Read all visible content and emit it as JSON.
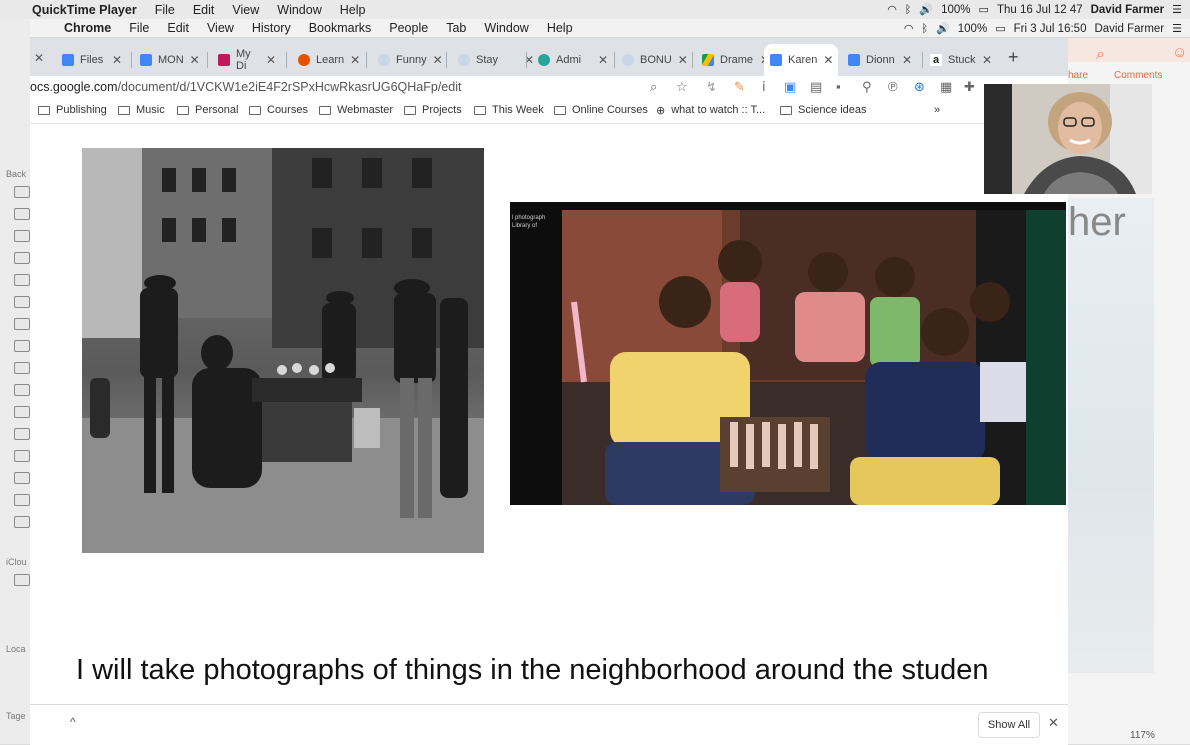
{
  "outer_menubar": {
    "app_name": "QuickTime Player",
    "items": [
      "File",
      "Edit",
      "View",
      "Window",
      "Help"
    ],
    "battery": "100%",
    "datetime": "Thu 16 Jul 12 47",
    "user": "David Farmer"
  },
  "inner_menubar": {
    "app_name": "Chrome",
    "items": [
      "File",
      "Edit",
      "View",
      "History",
      "Bookmarks",
      "People",
      "Tab",
      "Window",
      "Help"
    ],
    "battery": "100%",
    "datetime": "Fri 3 Jul 16:50",
    "user": "David Farmer"
  },
  "tabs": [
    {
      "label": "Files",
      "active": false,
      "color": "#4285f4"
    },
    {
      "label": "MON",
      "active": false,
      "color": "#4285f4"
    },
    {
      "label": "My Di",
      "active": false,
      "color": "#c2185b"
    },
    {
      "label": "Learn",
      "active": false,
      "color": "#e65100"
    },
    {
      "label": "Funny",
      "active": false,
      "color": "#bbbbbb"
    },
    {
      "label": "Stay",
      "active": false,
      "color": "#bbbbbb"
    },
    {
      "label": "Admi",
      "active": false,
      "color": "#26a69a"
    },
    {
      "label": "BONU",
      "active": false,
      "color": "#bbbbbb"
    },
    {
      "label": "Drame",
      "active": false,
      "color": "#fbbc04"
    },
    {
      "label": "Karen",
      "active": true,
      "color": "#4285f4"
    },
    {
      "label": "Dionn",
      "active": false,
      "color": "#4285f4"
    },
    {
      "label": "Stuck",
      "active": false,
      "color": "#222222"
    }
  ],
  "new_tab_symbol": "+",
  "url": {
    "host": "ocs.google.com",
    "path": "/document/d/1VCKW1e2iE4F2rSPxHcwRkasrUG6QHaFp/edit"
  },
  "bookmarks": [
    "Publishing",
    "Music",
    "Personal",
    "Courses",
    "Webmaster",
    "Projects",
    "This Week",
    "Online Courses",
    "what to watch :: T...",
    "Science ideas"
  ],
  "bookmarks_overflow": "»",
  "photo2_text": "l photograph\nLibrary of",
  "right_doc": {
    "share": "hare",
    "comments": "Comments",
    "big_text": "her",
    "zoom": "117%"
  },
  "bg_sidebar": {
    "back": "Back",
    "icloud": "iClou",
    "local": "Loca",
    "tags": "Tage"
  },
  "doc_caption": "I will take photographs of things in the neighborhood around the studen",
  "downloads": {
    "show_all": "Show All",
    "close": "✕",
    "chevron": "^"
  }
}
